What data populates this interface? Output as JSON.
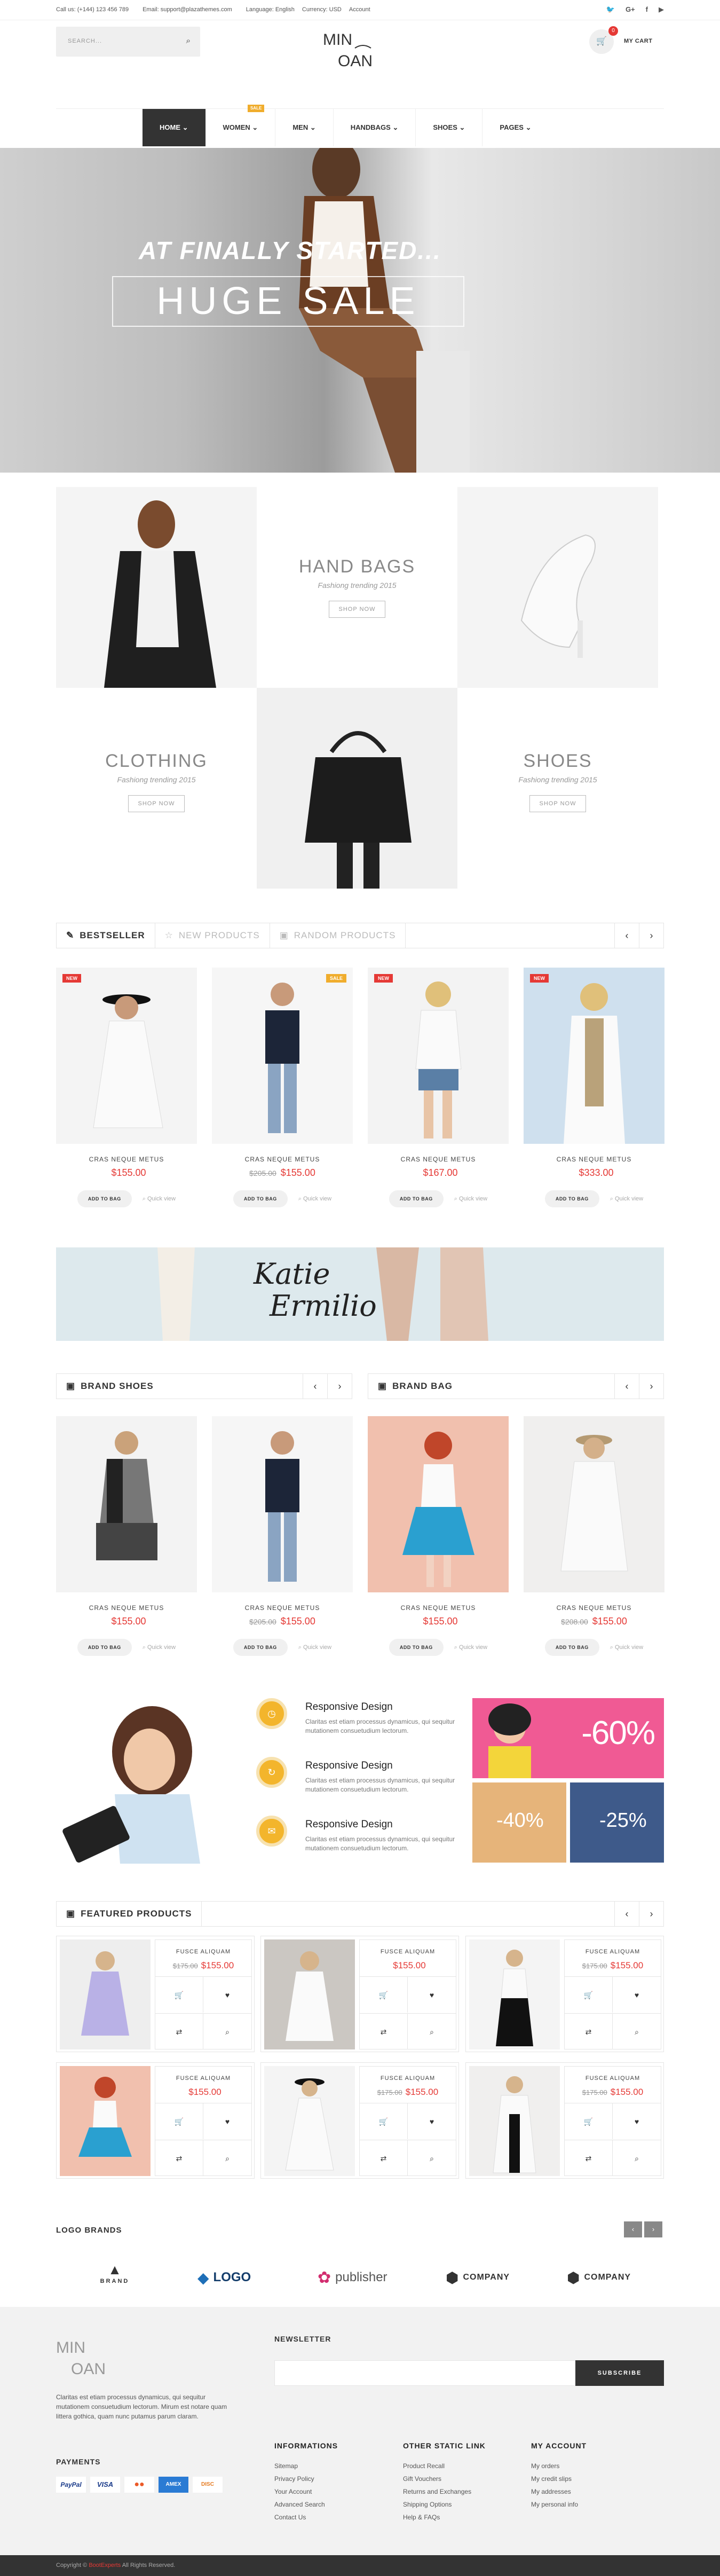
{
  "topbar": {
    "phone": "Call us: (+144) 123 456 789",
    "email": "Email: support@plazathemes.com",
    "language": "Language: English",
    "currency": "Currency: USD",
    "account": "Account"
  },
  "search": {
    "placeholder": "SEARCH..."
  },
  "logo": {
    "text_top": "MIN",
    "text_bottom": "OAN"
  },
  "cart": {
    "label": "MY CART",
    "count": "0"
  },
  "nav": {
    "items": [
      {
        "label": "HOME"
      },
      {
        "label": "WOMEN",
        "badge": "SALE"
      },
      {
        "label": "MEN"
      },
      {
        "label": "HANDBAGS"
      },
      {
        "label": "SHOES"
      },
      {
        "label": "PAGES"
      }
    ]
  },
  "hero": {
    "line1": "AT FINALLY STARTED...",
    "line2": "HUGE SALE"
  },
  "categories": [
    {
      "title": "HAND BAGS",
      "subtitle": "Fashiong trending 2015",
      "button": "SHOP NOW"
    },
    {
      "title": "CLOTHING",
      "subtitle": "Fashiong trending 2015",
      "button": "SHOP NOW"
    },
    {
      "title": "SHOES",
      "subtitle": "Fashiong trending 2015",
      "button": "SHOP NOW"
    }
  ],
  "tabs1": {
    "bestseller": "BESTSELLER",
    "new": "NEW PRODUCTS",
    "random": "RANDOM PRODUCTS"
  },
  "products1": [
    {
      "badge": "NEW",
      "name": "CRAS NEQUE METUS",
      "old": "",
      "price": "$155.00"
    },
    {
      "badge": "SALE",
      "name": "CRAS NEQUE METUS",
      "old": "$205.00",
      "price": "$155.00"
    },
    {
      "badge": "NEW",
      "name": "CRAS NEQUE METUS",
      "old": "",
      "price": "$167.00"
    },
    {
      "badge": "NEW",
      "name": "CRAS NEQUE METUS",
      "old": "",
      "price": "$333.00"
    }
  ],
  "actions": {
    "add": "ADD TO BAG",
    "quick": "Quick view"
  },
  "banner": {
    "line1": "Katie",
    "line2": "Ermilio"
  },
  "brand_shoes": {
    "title": "BRAND SHOES"
  },
  "brand_bag": {
    "title": "BRAND BAG"
  },
  "products2": [
    {
      "name": "CRAS NEQUE METUS",
      "old": "",
      "price": "$155.00"
    },
    {
      "name": "CRAS NEQUE METUS",
      "old": "$205.00",
      "price": "$155.00"
    },
    {
      "name": "CRAS NEQUE METUS",
      "old": "",
      "price": "$155.00"
    },
    {
      "name": "CRAS NEQUE METUS",
      "old": "$208.00",
      "price": "$155.00"
    }
  ],
  "features": [
    {
      "title": "Responsive Design",
      "desc": "Claritas est etiam processus dynamicus, qui sequitur mutationem consuetudium lectorum."
    },
    {
      "title": "Responsive Design",
      "desc": "Claritas est etiam processus dynamicus, qui sequitur mutationem consuetudium lectorum."
    },
    {
      "title": "Responsive Design",
      "desc": "Claritas est etiam processus dynamicus, qui sequitur mutationem consuetudium lectorum."
    }
  ],
  "promo": {
    "p1": "-60%",
    "p2": "-40%",
    "p3": "-25%"
  },
  "featured": {
    "title": "FEATURED PRODUCTS",
    "items": [
      {
        "name": "FUSCE ALIQUAM",
        "old": "$175.00",
        "price": "$155.00"
      },
      {
        "name": "FUSCE ALIQUAM",
        "old": "",
        "price": "$155.00"
      },
      {
        "name": "FUSCE ALIQUAM",
        "old": "$175.00",
        "price": "$155.00"
      },
      {
        "name": "FUSCE ALIQUAM",
        "old": "",
        "price": "$155.00"
      },
      {
        "name": "FUSCE ALIQUAM",
        "old": "$175.00",
        "price": "$155.00"
      },
      {
        "name": "FUSCE ALIQUAM",
        "old": "$175.00",
        "price": "$155.00"
      }
    ]
  },
  "brands": {
    "title": "LOGO BRANDS",
    "items": [
      {
        "label": "BRAND"
      },
      {
        "label": "LOGO"
      },
      {
        "label": "publisher"
      },
      {
        "label": "COMPANY"
      },
      {
        "label": "COMPANY"
      }
    ]
  },
  "footer": {
    "about": "Claritas est etiam processus dynamicus, qui sequitur mutationem consuetudium lectorum. Mirum est notare quam littera gothica, quam nunc putamus parum claram.",
    "payments": "PAYMENTS",
    "pay_items": [
      "PayPal",
      "VISA",
      "MC",
      "AMEX",
      "DISC"
    ],
    "newsletter": "NEWSLETTER",
    "subscribe": "SUBSCRIBE",
    "col1": {
      "title": "INFORMATIONS",
      "links": [
        "Sitemap",
        "Privacy Policy",
        "Your Account",
        "Advanced Search",
        "Contact Us"
      ]
    },
    "col2": {
      "title": "OTHER STATIC LINK",
      "links": [
        "Product Recall",
        "Gift Vouchers",
        "Returns and Exchanges",
        "Shipping Options",
        "Help & FAQs"
      ]
    },
    "col3": {
      "title": "MY ACCOUNT",
      "links": [
        "My orders",
        "My credit slips",
        "My addresses",
        "My personal info"
      ]
    },
    "copyright_pre": "Copyright ©",
    "copyright_brand": "BootExperts",
    "copyright_post": "All Rights Reserved."
  },
  "colors": {
    "accent": "#e53935",
    "badge_sale": "#f0ad2d",
    "feature": "#f3b52c",
    "dark": "#333333"
  }
}
